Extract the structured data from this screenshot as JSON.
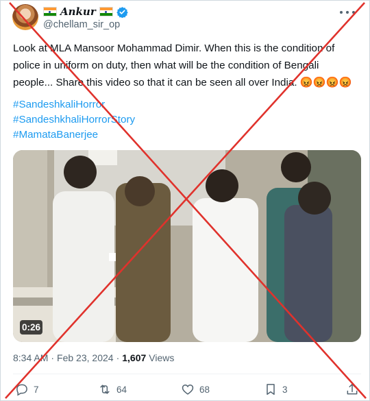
{
  "author": {
    "name": "Ankur",
    "handle": "@chellam_sir_op",
    "flag_colors": [
      "#ff9933",
      "#ffffff",
      "#138808"
    ]
  },
  "tweet": {
    "text": "Look at MLA Mansoor Mohammad Dimir. When this is the condition of police in uniform on duty, then what will be the condition of Bengali people... Share this video so that it can be seen all over India. 😡😡😡😡",
    "hashtags": [
      "#SandeshkaliHorror",
      "#SandeshkhaliHorrorStory",
      "#MamataBanerjee"
    ],
    "video_duration": "0:26",
    "time": "8:34 AM",
    "date": "Feb 23, 2024",
    "views_count": "1,607",
    "views_label": "Views",
    "separator": "·"
  },
  "actions": {
    "replies": "7",
    "reposts": "64",
    "likes": "68",
    "bookmarks": "3"
  },
  "colors": {
    "link": "#1d9bf0",
    "muted": "#536471",
    "verified": "#1d9bf0",
    "overlay_cross": "#e0322c"
  },
  "icons": [
    "verified-badge-icon",
    "more-icon",
    "reply-icon",
    "repost-icon",
    "like-icon",
    "bookmark-icon",
    "share-icon"
  ]
}
